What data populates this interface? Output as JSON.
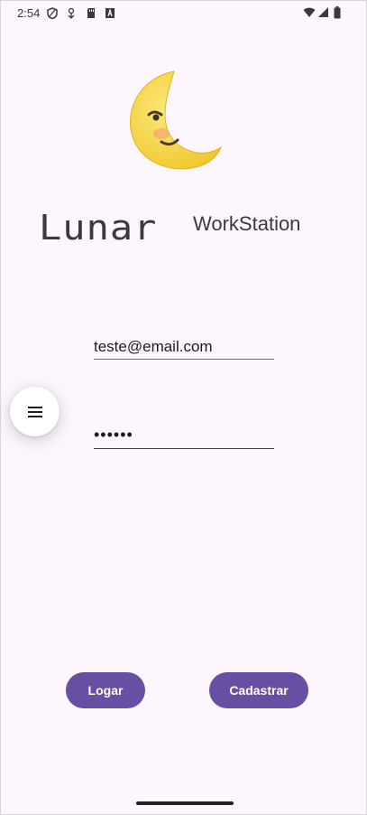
{
  "status_bar": {
    "time": "2:54"
  },
  "brand": {
    "logo": "moon-emoji",
    "title": "Lunar",
    "subtitle": "WorkStation"
  },
  "form": {
    "email_value": "teste@email.com",
    "password_value": "••••••"
  },
  "menu": {
    "icon": "hamburger-menu-icon"
  },
  "buttons": {
    "login_label": "Logar",
    "signup_label": "Cadastrar"
  },
  "colors": {
    "primary": "#6750a4",
    "background": "#fdf7fd",
    "moon": "#f8d84a"
  }
}
